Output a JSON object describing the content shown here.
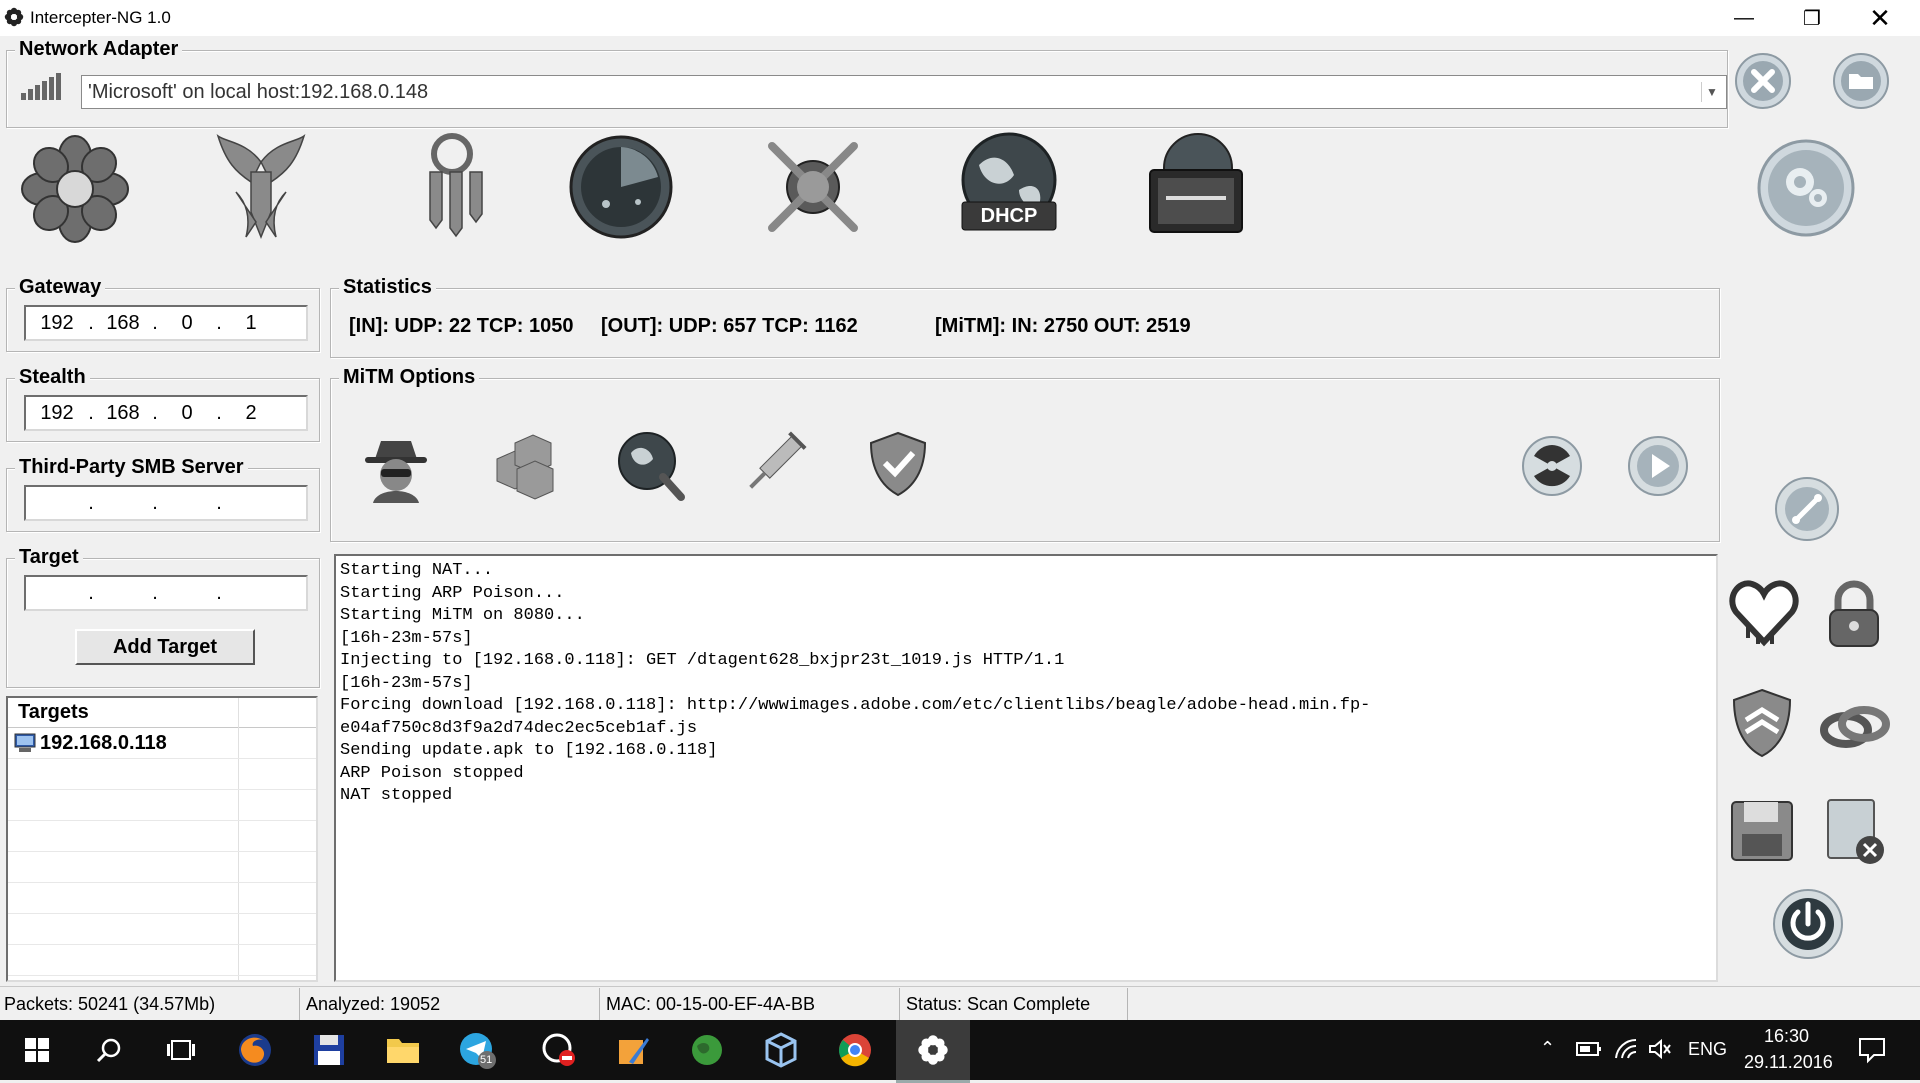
{
  "window": {
    "title": "Intercepter-NG 1.0"
  },
  "network_adapter": {
    "label": "Network Adapter",
    "selected": "'Microsoft' on local host:192.168.0.148"
  },
  "tools": [
    "sniffer-flower-icon",
    "resurrection-phoenix-icon",
    "passwords-keys-icon",
    "scanner-radar-icon",
    "ray-mode-icon",
    "dhcp-globe-icon",
    "raw-mode-monitor-icon"
  ],
  "dhcp_label": "DHCP",
  "gateway": {
    "label": "Gateway",
    "octets": [
      "192",
      "168",
      "0",
      "1"
    ]
  },
  "stealth": {
    "label": "Stealth",
    "octets": [
      "192",
      "168",
      "0",
      "2"
    ]
  },
  "smb": {
    "label": "Third-Party SMB Server",
    "octets": [
      "",
      "",
      "",
      ""
    ]
  },
  "target": {
    "label": "Target",
    "octets": [
      "",
      "",
      "",
      ""
    ],
    "add_button": "Add Target"
  },
  "targets_list": {
    "header": "Targets",
    "items": [
      "192.168.0.118"
    ]
  },
  "statistics": {
    "label": "Statistics",
    "in": "[IN]: UDP: 22 TCP: 1050",
    "out": "[OUT]: UDP: 657 TCP: 1162",
    "mitm": "[MiTM]: IN: 2750 OUT: 2519"
  },
  "mitm_options": {
    "label": "MiTM Options"
  },
  "log": [
    "Starting NAT...",
    "Starting ARP Poison...",
    "Starting MiTM on 8080...",
    "[16h-23m-57s]",
    "Injecting to [192.168.0.118]: GET /dtagent628_bxjpr23t_1019.js HTTP/1.1",
    "[16h-23m-57s]",
    "Forcing download [192.168.0.118]: http://wwwimages.adobe.com/etc/clientlibs/beagle/adobe-head.min.fp-",
    "e04af750c8d3f9a2d74dec2ec5ceb1af.js",
    "Sending update.apk to [192.168.0.118]",
    "ARP Poison stopped",
    "NAT stopped"
  ],
  "statusbar": {
    "packets": "Packets: 50241 (34.57Mb)",
    "analyzed": "Analyzed: 19052",
    "mac": "MAC: 00-15-00-EF-4A-BB",
    "status": "Status: Scan Complete"
  },
  "taskbar": {
    "lang": "ENG",
    "time": "16:30",
    "date": "29.11.2016",
    "telegram_badge": "51"
  },
  "colors": {
    "window_bg": "#f0f0f0",
    "taskbar_bg": "#101010",
    "icon_gray": "#5a5a5a"
  }
}
